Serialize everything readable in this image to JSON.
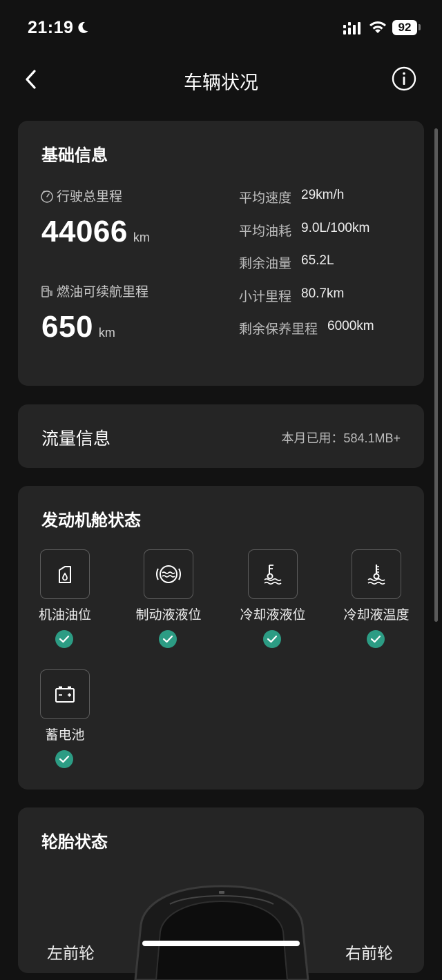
{
  "status_bar": {
    "time": "21:19",
    "battery": "92"
  },
  "nav": {
    "title": "车辆状况"
  },
  "basic": {
    "title": "基础信息",
    "total_mileage": {
      "label": "行驶总里程",
      "value": "44066",
      "unit": "km"
    },
    "range": {
      "label": "燃油可续航里程",
      "value": "650",
      "unit": "km"
    },
    "stats": [
      {
        "key": "平均速度",
        "value": "29km/h"
      },
      {
        "key": "平均油耗",
        "value": "9.0L/100km"
      },
      {
        "key": "剩余油量",
        "value": "65.2L"
      },
      {
        "key": "小计里程",
        "value": "80.7km"
      },
      {
        "key": "剩余保养里程",
        "value": "6000km"
      }
    ]
  },
  "flow": {
    "title": "流量信息",
    "used": "本月已用：584.1MB+"
  },
  "engine": {
    "title": "发动机舱状态",
    "items": [
      {
        "label": "机油油位",
        "icon": "oil-can-icon",
        "status": "ok"
      },
      {
        "label": "制动液液位",
        "icon": "brake-fluid-icon",
        "status": "ok"
      },
      {
        "label": "冷却液液位",
        "icon": "coolant-level-icon",
        "status": "ok"
      },
      {
        "label": "冷却液温度",
        "icon": "coolant-temp-icon",
        "status": "ok"
      },
      {
        "label": "蓄电池",
        "icon": "battery-icon",
        "status": "ok"
      }
    ]
  },
  "tire": {
    "title": "轮胎状态",
    "front_left": "左前轮",
    "front_right": "右前轮"
  },
  "colors": {
    "background": "#121212",
    "card": "#252525",
    "ok_badge": "#2c9c84"
  }
}
